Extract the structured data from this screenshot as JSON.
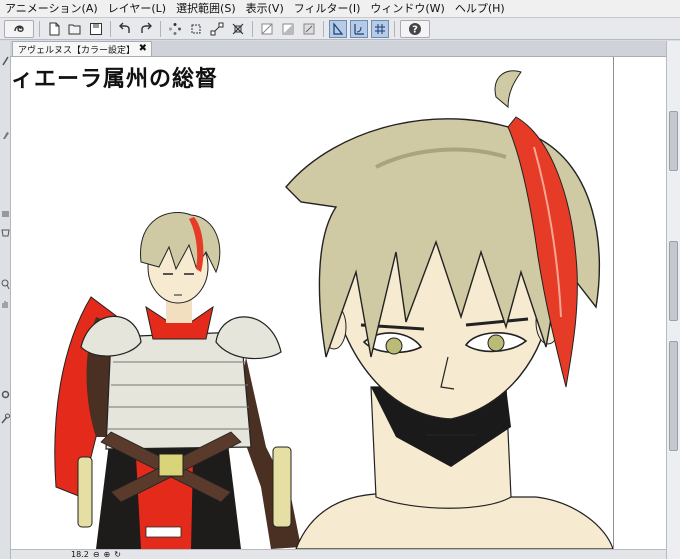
{
  "menu": [
    "アニメーション(A)",
    "レイヤー(L)",
    "選択範囲(S)",
    "表示(V)",
    "フィルター(I)",
    "ウィンドウ(W)",
    "ヘルプ(H)"
  ],
  "toolbar": {
    "icons": [
      "app-logo-icon",
      "new-file-icon",
      "open-folder-icon",
      "save-icon",
      "undo-icon",
      "redo-icon",
      "loading-icon",
      "crop-icon",
      "transform-icon",
      "eyedropper-icon",
      "clear-icon",
      "fill-icon",
      "snap-ruler-icon",
      "snap-special-icon",
      "snap-grid-icon",
      "help-icon"
    ],
    "help_label": "?"
  },
  "document_tab": {
    "title": "アヴェルヌス【カラー設定】",
    "close": "✖"
  },
  "canvas": {
    "title_text": "ィエーラ属州の総督"
  },
  "status": {
    "zoom": "18.2"
  },
  "colors": {
    "hair": "#cfcaa4",
    "hair_streak": "#e63b26",
    "armor": "#e6e5db",
    "cape": "#e42b1b",
    "skin": "#f6ead0",
    "leather": "#5a3a2b",
    "ui_accent": "#b6cbe6"
  }
}
